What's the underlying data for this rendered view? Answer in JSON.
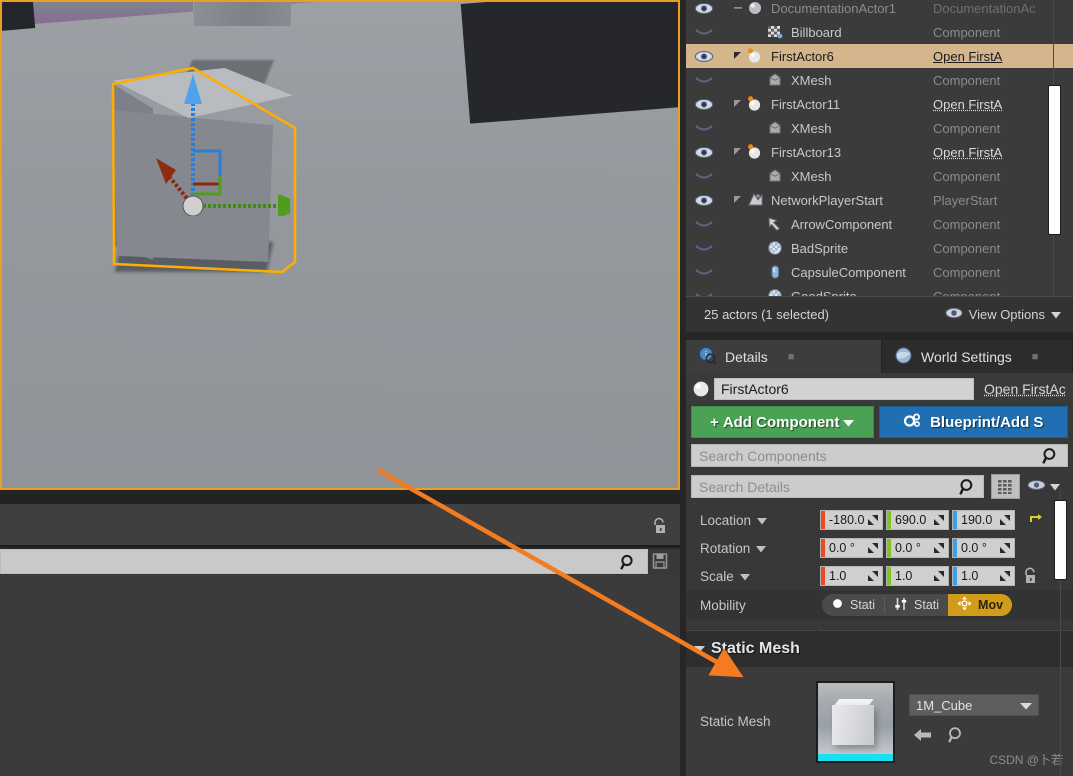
{
  "outliner": {
    "rows": [
      {
        "label": "DocumentationActor1",
        "type": "DocumentationAc",
        "eye": true,
        "indent": 1,
        "arrow": "collapse",
        "icon": "actor-icon",
        "selected": false,
        "linked": false,
        "dim": true
      },
      {
        "label": "Billboard",
        "type": "Component",
        "eye": false,
        "indent": 3,
        "arrow": "none",
        "icon": "billboard-icon",
        "selected": false,
        "linked": false,
        "dim": false
      },
      {
        "label": "FirstActor6",
        "type": "Open FirstA",
        "eye": true,
        "indent": 1,
        "arrow": "expand",
        "icon": "blueprint-actor-icon",
        "selected": true,
        "linked": true,
        "dim": false
      },
      {
        "label": "XMesh",
        "type": "Component",
        "eye": false,
        "indent": 3,
        "arrow": "none",
        "icon": "mesh-icon",
        "selected": false,
        "linked": false,
        "dim": false
      },
      {
        "label": "FirstActor11",
        "type": "Open FirstA",
        "eye": true,
        "indent": 1,
        "arrow": "expand",
        "icon": "blueprint-actor-icon",
        "selected": false,
        "linked": true,
        "dim": false
      },
      {
        "label": "XMesh",
        "type": "Component",
        "eye": false,
        "indent": 3,
        "arrow": "none",
        "icon": "mesh-icon",
        "selected": false,
        "linked": false,
        "dim": false
      },
      {
        "label": "FirstActor13",
        "type": "Open FirstA",
        "eye": true,
        "indent": 1,
        "arrow": "expand",
        "icon": "blueprint-actor-icon",
        "selected": false,
        "linked": true,
        "dim": false
      },
      {
        "label": "XMesh",
        "type": "Component",
        "eye": false,
        "indent": 3,
        "arrow": "none",
        "icon": "mesh-icon",
        "selected": false,
        "linked": false,
        "dim": false
      },
      {
        "label": "NetworkPlayerStart",
        "type": "PlayerStart",
        "eye": true,
        "indent": 1,
        "arrow": "expand",
        "icon": "playerstart-icon",
        "selected": false,
        "linked": false,
        "dim": false
      },
      {
        "label": "ArrowComponent",
        "type": "Component",
        "eye": false,
        "indent": 3,
        "arrow": "none",
        "icon": "arrow-component-icon",
        "selected": false,
        "linked": false,
        "dim": false
      },
      {
        "label": "BadSprite",
        "type": "Component",
        "eye": false,
        "indent": 3,
        "arrow": "none",
        "icon": "sprite-icon",
        "selected": false,
        "linked": false,
        "dim": false
      },
      {
        "label": "CapsuleComponent",
        "type": "Component",
        "eye": false,
        "indent": 3,
        "arrow": "none",
        "icon": "capsule-icon",
        "selected": false,
        "linked": false,
        "dim": false
      },
      {
        "label": "GoodSprite",
        "type": "Component",
        "eye": false,
        "indent": 3,
        "arrow": "none",
        "icon": "sprite-icon",
        "selected": false,
        "linked": false,
        "dim": false
      }
    ],
    "footer": {
      "status": "25 actors (1 selected)",
      "view_options_label": "View Options"
    }
  },
  "details": {
    "tabs": [
      {
        "label": "Details",
        "icon": "details-info-icon",
        "active": true
      },
      {
        "label": "World Settings",
        "icon": "globe-icon",
        "active": false
      }
    ],
    "actor_name": "FirstActor6",
    "open_blueprint_link": "Open FirstAc",
    "buttons": {
      "add_component": "Add Component",
      "blueprint_add_script": "Blueprint/Add S"
    },
    "search_components_placeholder": "Search Components",
    "search_details_placeholder": "Search Details",
    "transform": {
      "location": {
        "label": "Location",
        "x": "-180.0",
        "y": "690.0",
        "z": "190.0"
      },
      "rotation": {
        "label": "Rotation",
        "x": "0.0 °",
        "y": "0.0 °",
        "z": "0.0 °"
      },
      "scale": {
        "label": "Scale",
        "x": "1.0",
        "y": "1.0",
        "z": "1.0"
      },
      "mobility": {
        "label": "Mobility",
        "options": [
          "Stati",
          "Stati",
          "Mov"
        ],
        "selected_index": 2
      }
    },
    "static_mesh_category": {
      "title": "Static Mesh",
      "row_label": "Static Mesh",
      "asset_name": "1M_Cube"
    }
  },
  "colors": {
    "accent_orange": "#f47b20",
    "selection_tan": "#d4b58c",
    "green_button": "#4aa254",
    "blue_button": "#1f6fb2",
    "mobility_active": "#d29c1b",
    "axis_x": "#e84a22",
    "axis_y": "#7fc421",
    "axis_z": "#3ba0e8",
    "thumb_bar_cyan": "#18e0ee",
    "viewport_border": "#e8a020"
  },
  "watermark": "CSDN @卜若"
}
